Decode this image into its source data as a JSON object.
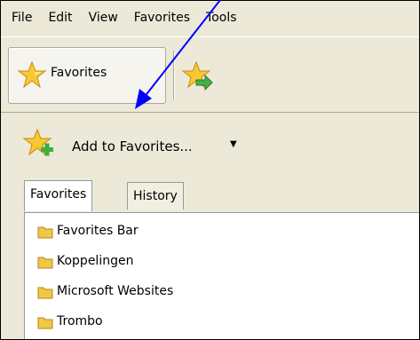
{
  "menubar": {
    "items": [
      {
        "label": "File"
      },
      {
        "label": "Edit"
      },
      {
        "label": "View"
      },
      {
        "label": "Favorites"
      },
      {
        "label": "Tools"
      }
    ]
  },
  "toolbar": {
    "favorites_label": "Favorites",
    "favorites_icon": "star-icon",
    "add_icon": "star-add-arrow-icon"
  },
  "pane": {
    "add_label": "Add to Favorites...",
    "add_caret": "▼",
    "tabs": [
      {
        "label": "Favorites"
      },
      {
        "label": "History"
      }
    ],
    "items": [
      {
        "label": "Favorites Bar"
      },
      {
        "label": "Koppelingen"
      },
      {
        "label": "Microsoft Websites"
      },
      {
        "label": "Trombo"
      }
    ]
  },
  "annotation": {
    "arrow_color": "#0000ff"
  },
  "colors": {
    "star": "#f5c518",
    "folder": "#f2c744",
    "add_green": "#3fae3f"
  }
}
